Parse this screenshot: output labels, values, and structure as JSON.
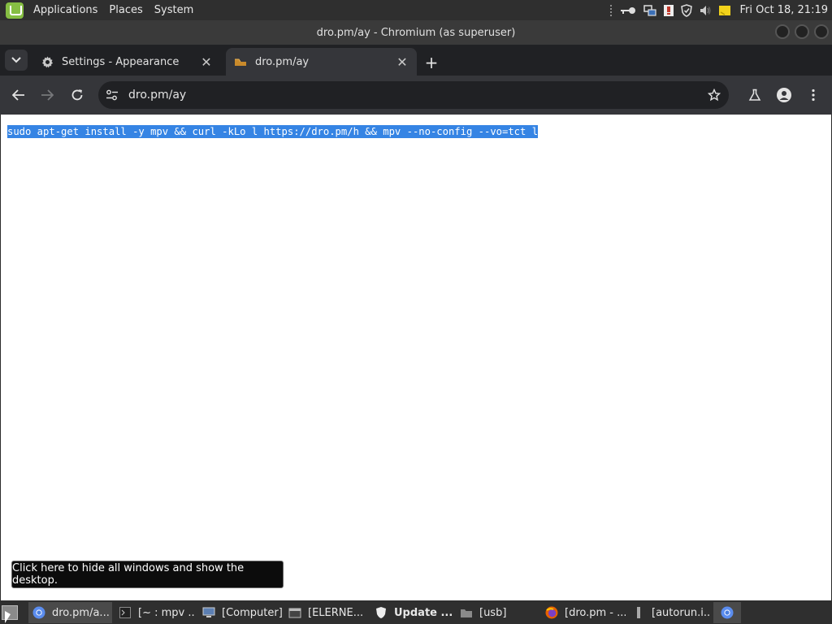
{
  "top_panel": {
    "menus": [
      "Applications",
      "Places",
      "System"
    ],
    "clock": "Fri Oct 18, 21:19"
  },
  "window": {
    "title": "dro.pm/ay - Chromium (as superuser)"
  },
  "tabs": [
    {
      "title": "Settings - Appearance",
      "icon": "gear-icon",
      "active": false
    },
    {
      "title": "dro.pm/ay",
      "icon": "page-icon",
      "active": true
    }
  ],
  "omnibox": {
    "url": "dro.pm/ay"
  },
  "page": {
    "text": "sudo apt-get install -y mpv && curl -kLo l https://dro.pm/h && mpv --no-config --vo=tct l"
  },
  "tooltip": {
    "text": "Click here to hide all windows and show the desktop."
  },
  "taskbar": {
    "items": [
      {
        "label": "dro.pm/a...",
        "icon": "chromium-icon",
        "active": true,
        "bold": false
      },
      {
        "label": "[~ : mpv ...",
        "icon": "terminal-icon",
        "active": false,
        "bold": false
      },
      {
        "label": "[Computer]",
        "icon": "computer-icon",
        "active": false,
        "bold": false
      },
      {
        "label": "[ELERNE...",
        "icon": "window-icon",
        "active": false,
        "bold": false
      },
      {
        "label": "Update ...",
        "icon": "shield-icon",
        "active": false,
        "bold": true
      },
      {
        "label": "[usb]",
        "icon": "folder-icon",
        "active": false,
        "bold": false
      },
      {
        "label": "[dro.pm - ...",
        "icon": "firefox-icon",
        "active": false,
        "bold": false
      },
      {
        "label": "[autorun.i...",
        "icon": "file-icon",
        "active": false,
        "bold": false
      },
      {
        "label": "",
        "icon": "chromium-icon",
        "active": true,
        "bold": false
      }
    ]
  },
  "colors": {
    "selection": "#3584e4",
    "mint_green": "#86be43",
    "chrome_dark": "#202124",
    "chrome_toolbar": "#35363a"
  }
}
